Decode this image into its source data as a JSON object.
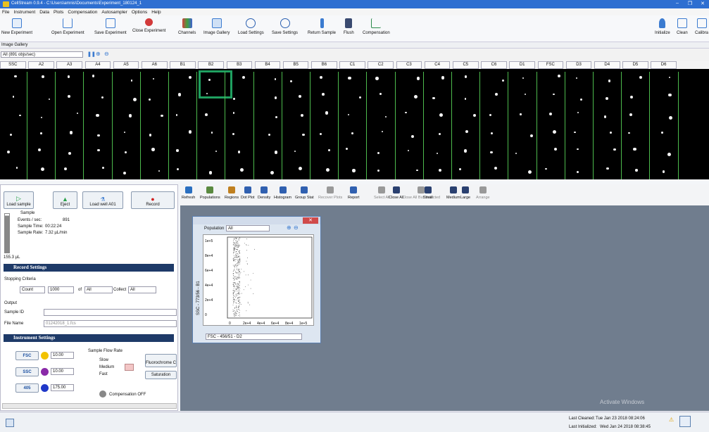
{
  "window": {
    "title": "CellStream 0.9.4 - C:\\Users\\amnis\\Documents\\Experiment_180124_1",
    "min": "–",
    "max": "❐",
    "close": "✕"
  },
  "menu": [
    "File",
    "Instrument",
    "Data",
    "Plots",
    "Compensation",
    "Autosampler",
    "Options",
    "Help"
  ],
  "toolbar": {
    "new_experiment": "New Experiment",
    "open_experiment": "Open Experiment",
    "save_experiment": "Save Experiment",
    "close_experiment": "Close Experiment",
    "channels": "Channels",
    "image_gallery": "Image Gallery",
    "load_settings": "Load Settings",
    "save_settings": "Save Settings",
    "return_sample": "Return Sample",
    "flush": "Flush",
    "compensation": "Compensation",
    "initialize": "Initialize",
    "clean": "Clean",
    "calibrate": "Calibra"
  },
  "image_gallery": {
    "label": "Image Gallery",
    "rate_select": "All (891 objs/sec)",
    "columns": [
      "SSC",
      "A2",
      "A3",
      "A4",
      "A5",
      "A6",
      "B1",
      "B2",
      "B3",
      "B4",
      "B5",
      "B6",
      "C1",
      "C2",
      "C3",
      "C4",
      "C5",
      "C6",
      "D1",
      "FSC",
      "D3",
      "D4",
      "D5",
      "D6"
    ]
  },
  "sample_panel": {
    "load_sample": "Load sample",
    "eject": "Eject",
    "load_well": "Load well A01",
    "record": "Record",
    "sample_heading": "Sample",
    "events_label": "Events / sec:",
    "events_value": "891",
    "sample_time_label": "Sample Time:",
    "sample_time_value": "00:22:24",
    "sample_rate_label": "Sample Rate:",
    "sample_rate_value": "7.32 µL/min",
    "volume": "155.3 µL"
  },
  "record_settings": {
    "title": "Record Settings",
    "stopping_criteria": "Stopping Criteria",
    "count_select": "Count",
    "count_value": "1000",
    "of": "of",
    "of_select": "All",
    "collect": "Collect",
    "collect_select": "All",
    "output": "Output",
    "sample_id_label": "Sample ID",
    "sample_id_value": "",
    "file_name_label": "File Name",
    "file_name_value": "01242018_1.fcs"
  },
  "instrument_settings": {
    "title": "Instrument Settings",
    "flow_rate_title": "Sample Flow Rate",
    "flow_options": [
      "Slow",
      "Medium",
      "Fast"
    ],
    "channels": [
      {
        "name": "FSC",
        "value": "10.00",
        "color": "#f2c200"
      },
      {
        "name": "SSC",
        "value": "10.00",
        "color": "#8a2aa8"
      },
      {
        "name": "405",
        "value": "175.00",
        "color": "#2038c8"
      }
    ],
    "fluorochrome": "Fluorochrome C",
    "saturation": "Saturation",
    "compensation": "Compensation OFF"
  },
  "plot_toolbar": [
    "Refresh",
    "Populations",
    "Regions",
    "Dot Plot",
    "Density",
    "Histogram",
    "Group Stat",
    "Recover Plots",
    "Report",
    "Select All",
    "Close All",
    "Close All But Selected",
    "Small",
    "Medium",
    "Large",
    "Arrange"
  ],
  "plot_window": {
    "population_label": "Population",
    "population_select": "All",
    "y_axis_label": "SSC - 773/56 - B1",
    "x_axis_select": "FSC - 456/51 - D2",
    "y_ticks": [
      "1e+5",
      "8e+4",
      "6e+4",
      "4e+4",
      "2e+4",
      "0"
    ],
    "x_ticks": [
      "0",
      "2e+4",
      "4e+4",
      "6e+4",
      "8e+4",
      "1e+5"
    ]
  },
  "status": {
    "last_cleaned_label": "Last Cleaned:",
    "last_cleaned_value": "Tue Jan 23 2018 08:24:06",
    "last_initialized_label": "Last Initialized:",
    "last_initialized_value": "Wed Jan 24 2018 08:38:45",
    "watermark": "Activate Windows"
  }
}
